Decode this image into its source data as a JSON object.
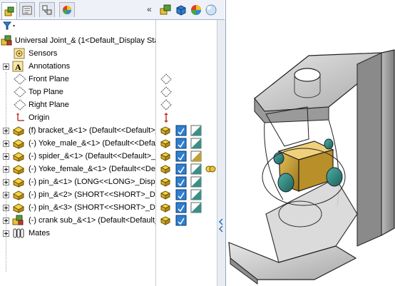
{
  "tabs": [
    {
      "icon": "feature-manager-icon",
      "active": true
    },
    {
      "icon": "property-manager-icon",
      "active": false
    },
    {
      "icon": "configuration-manager-icon",
      "active": false
    },
    {
      "icon": "appearance-manager-icon",
      "active": false
    }
  ],
  "collapse_label": "«",
  "tree": {
    "root": "Universal Joint_& (1<Default_Display State",
    "items": [
      {
        "label": "Sensors",
        "icon": "sensor-icon",
        "expand": false
      },
      {
        "label": "Annotations",
        "icon": "annotations-icon",
        "expand": true
      },
      {
        "label": "Front Plane",
        "icon": "plane-icon",
        "expand": false
      },
      {
        "label": "Top Plane",
        "icon": "plane-icon",
        "expand": false
      },
      {
        "label": "Right Plane",
        "icon": "plane-icon",
        "expand": false
      },
      {
        "label": "Origin",
        "icon": "origin-icon",
        "expand": false
      },
      {
        "label": "(f) bracket_&<1> (Default<<Default>_Di",
        "icon": "part-icon",
        "expand": true
      },
      {
        "label": "(-) Yoke_male_&<1> (Default<<Default>_",
        "icon": "part-icon",
        "expand": true
      },
      {
        "label": "(-) spider_&<1> (Default<<Default>_Dis",
        "icon": "part-icon",
        "expand": true
      },
      {
        "label": "(-) Yoke_female_&<1> (Default<<Defau",
        "icon": "part-icon",
        "expand": true
      },
      {
        "label": "(-) pin_&<1> (LONG<<LONG>_Display",
        "icon": "part-icon",
        "expand": true
      },
      {
        "label": "(-) pin_&<2> (SHORT<<SHORT>_Disp",
        "icon": "part-icon",
        "expand": true
      },
      {
        "label": "(-) pin_&<3> (SHORT<<SHORT>_Disp",
        "icon": "part-icon",
        "expand": true
      },
      {
        "label": "(-) crank sub_&<1> (Default<Default_D",
        "icon": "subassembly-icon",
        "expand": true
      },
      {
        "label": "Mates",
        "icon": "mates-icon",
        "expand": true
      }
    ]
  },
  "display_columns": [
    "display-state-icon",
    "display-mode-icon",
    "appearance-icon",
    "transparency-icon"
  ]
}
